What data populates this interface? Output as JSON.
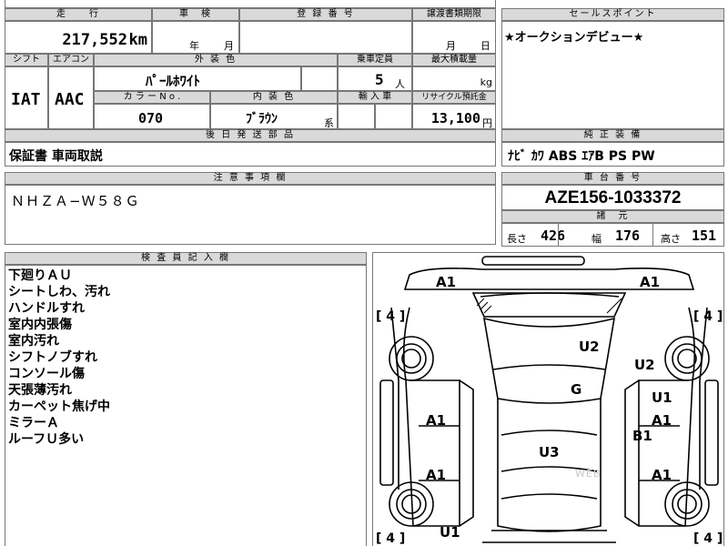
{
  "header": {
    "mileage_label": "走　　行",
    "inspection_label": "車　検",
    "registration_label": "登 録 番 号",
    "transfer_deadline_label": "譲渡書類期限",
    "sales_point_label": "セールスポイント"
  },
  "mileage": {
    "value": "217,552",
    "unit": "km"
  },
  "inspection": {
    "year_unit": "年",
    "month_unit": "月"
  },
  "transfer_deadline": {
    "month_unit": "月",
    "day_unit": "日"
  },
  "labels": {
    "shift": "シフト",
    "aircon": "エアコン",
    "exterior_color": "外 装 色",
    "seating": "乗車定員",
    "max_load": "最大積載量",
    "color_no": "カ ラ ー N o .",
    "interior_color": "内 装 色",
    "import": "輸 入 車",
    "recycle": "リサイクル預託金",
    "later_parts": "後 日 発 送 部 品",
    "genuine_equipment": "純 正 装 備",
    "notes": "注 意 事 項 欄",
    "chassis_no": "車 台 番 号",
    "specs": "諸　元",
    "inspector_notes": "検 査 員 記 入 欄"
  },
  "vehicle": {
    "shift": "IAT",
    "aircon": "AAC",
    "exterior_color": "ﾊﾟｰﾙﾎﾜｲﾄ",
    "seating": "5",
    "seating_unit": "人",
    "load_unit": "kg",
    "color_no": "070",
    "interior_color": "ﾌﾞﾗｳﾝ",
    "interior_suffix": "系",
    "recycle_fee": "13,100",
    "recycle_unit": "円",
    "later_parts": "保証書 車両取説",
    "sales_point": "★オークションデビュー★",
    "genuine_equipment": "ﾅﾋﾞ ｶﾜ ABS ｴｱB PS PW",
    "notes": "ＮＨＺＡ−Ｗ５８Ｇ",
    "chassis_no": "AZE156-1033372"
  },
  "specs": {
    "length_label": "長さ",
    "length": "426",
    "width_label": "幅",
    "width": "176",
    "height_label": "高さ",
    "height": "151"
  },
  "inspector_notes": [
    "下廻りＡＵ",
    "シートしわ、汚れ",
    "ハンドルすれ",
    "室内内張傷",
    "室内汚れ",
    "シフトノブすれ",
    "コンソール傷",
    "天張薄汚れ",
    "カーペット焦げ中",
    "ミラーＡ",
    "ルーフＵ多い"
  ],
  "diagram": {
    "tire_marks": [
      "[ 4 ]",
      "[ 4 ]",
      "[ 4 ]",
      "[ 4 ]"
    ],
    "damage_codes": [
      "A1",
      "A1",
      "U2",
      "U2",
      "G",
      "U1",
      "A1",
      "A1",
      "B1",
      "U3",
      "A1",
      "A1",
      "U1"
    ],
    "watermark": "WEB"
  }
}
